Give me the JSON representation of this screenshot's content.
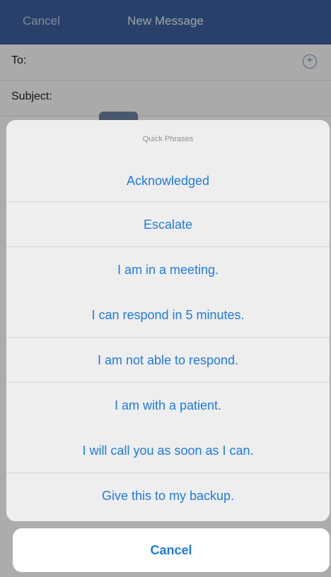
{
  "navbar": {
    "cancel_label": "Cancel",
    "title": "New Message"
  },
  "form": {
    "to_label": "To:",
    "subject_label": "Subject:",
    "add_icon": "plus-circle-icon"
  },
  "sheet": {
    "title": "Quick Phrases",
    "phrases": [
      "Acknowledged",
      "Escalate",
      "I am in a meeting.",
      "I can respond in 5 minutes.",
      "I am not able to respond.",
      "I am with a patient.",
      "I will call you as soon as I can.",
      "Give this to my backup."
    ],
    "cancel_label": "Cancel"
  }
}
